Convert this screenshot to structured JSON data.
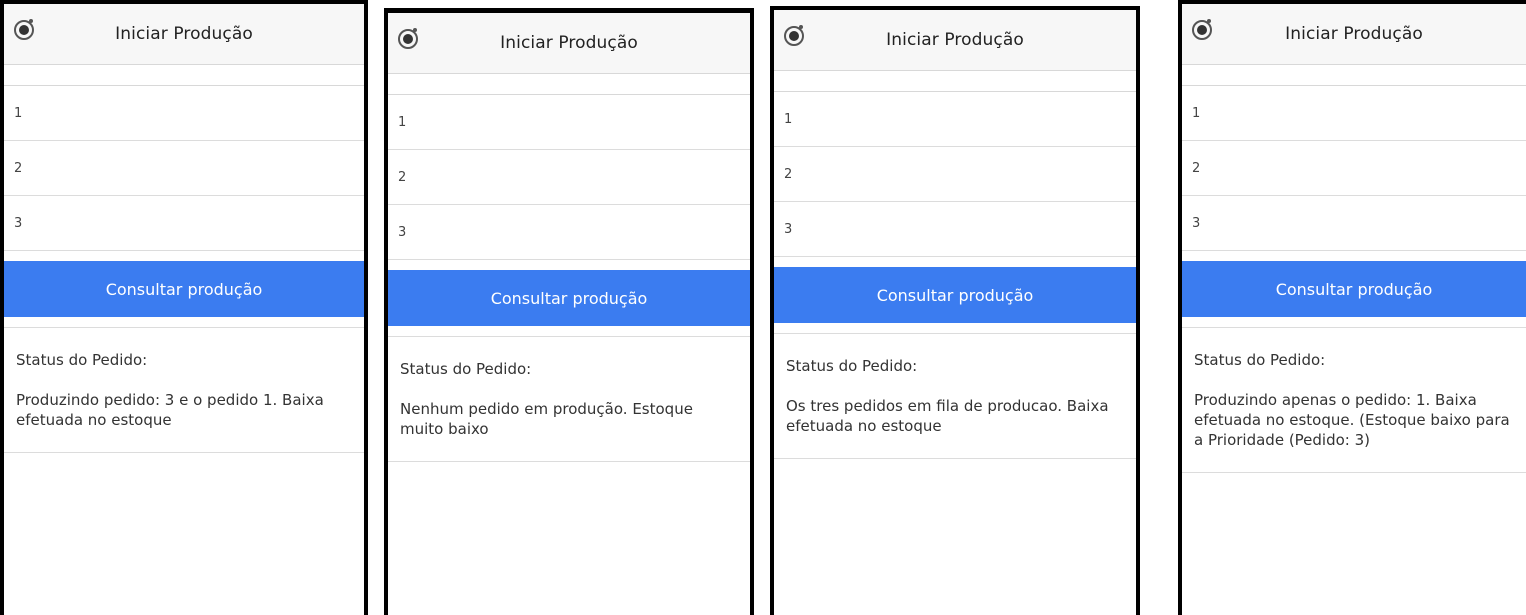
{
  "panels": [
    {
      "header": {
        "title": "Iniciar Produção"
      },
      "items": [
        "1",
        "2",
        "3"
      ],
      "button": "Consultar produção",
      "status_label": "Status do Pedido:",
      "status_text": "Produzindo pedido: 3 e o pedido 1. Baixa efetuada no estoque"
    },
    {
      "header": {
        "title": "Iniciar Produção"
      },
      "items": [
        "1",
        "2",
        "3"
      ],
      "button": "Consultar produção",
      "status_label": "Status do Pedido:",
      "status_text": "Nenhum pedido em produção. Estoque muito baixo"
    },
    {
      "header": {
        "title": "Iniciar Produção"
      },
      "items": [
        "1",
        "2",
        "3"
      ],
      "button": "Consultar produção",
      "status_label": "Status do Pedido:",
      "status_text": "Os tres pedidos em fila de producao. Baixa efetuada no estoque"
    },
    {
      "header": {
        "title": "Iniciar Produção"
      },
      "items": [
        "1",
        "2",
        "3"
      ],
      "button": "Consultar produção",
      "status_label": "Status do Pedido:",
      "status_text": "Produzindo apenas o pedido: 1. Baixa efetuada no estoque. (Estoque baixo para a Prioridade (Pedido: 3)"
    }
  ],
  "colors": {
    "button": "#3b7cf0",
    "header_bg": "#f7f7f7",
    "frame": "#000000"
  },
  "icons": {
    "header": "ionic-logo-icon"
  }
}
